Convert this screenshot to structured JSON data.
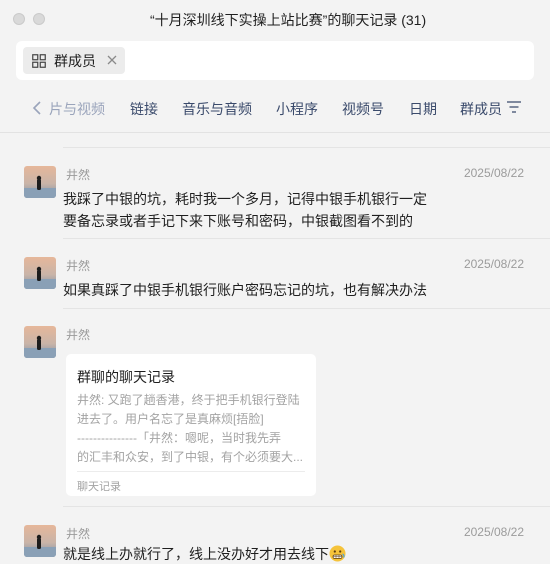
{
  "window": {
    "title": "“十月深圳线下实操上站比赛”的聊天记录 (31)"
  },
  "filter": {
    "tag_label": "群成员"
  },
  "tabs": [
    {
      "label": "片与视频"
    },
    {
      "label": "链接"
    },
    {
      "label": "音乐与音频"
    },
    {
      "label": "小程序"
    },
    {
      "label": "视频号"
    },
    {
      "label": "日期"
    },
    {
      "label": "群成员"
    }
  ],
  "messages": [
    {
      "sender": "井然",
      "date": "2025/08/22",
      "text_line1": "我踩了中银的坑，耗时我一个多月，记得中银手机银行一定",
      "text_line2": "要备忘录或者手记下来下账号和密码，中银截图看不到的"
    },
    {
      "sender": "井然",
      "date": "2025/08/22",
      "text_line1": "如果真踩了中银手机银行账户密码忘记的坑，也有解决办法"
    },
    {
      "sender": "井然",
      "date": "",
      "card": {
        "title": "群聊的聊天记录",
        "line1": "井然: 又跑了趟香港，终于把手机银行登陆",
        "line2": "进去了。用户名忘了是真麻烦[捂脸]",
        "line3": "---------------「井然：嗯呢，当时我先弄",
        "line4": "的汇丰和众安，到了中银，有个必须要大...",
        "footer": "聊天记录"
      }
    },
    {
      "sender": "井然",
      "date": "2025/08/22",
      "text_line1": "就是线上办就行了，线上没办好才用去线下"
    }
  ],
  "icons": {
    "grid": "grid-icon",
    "close": "close-icon",
    "back": "chevron-left-icon",
    "filter": "filter-icon",
    "emoji": "grimacing-emoji-icon"
  },
  "colors": {
    "tab_text": "#3a4a6b",
    "meta_text": "#9b9b9b",
    "background": "#f3f3f3"
  }
}
